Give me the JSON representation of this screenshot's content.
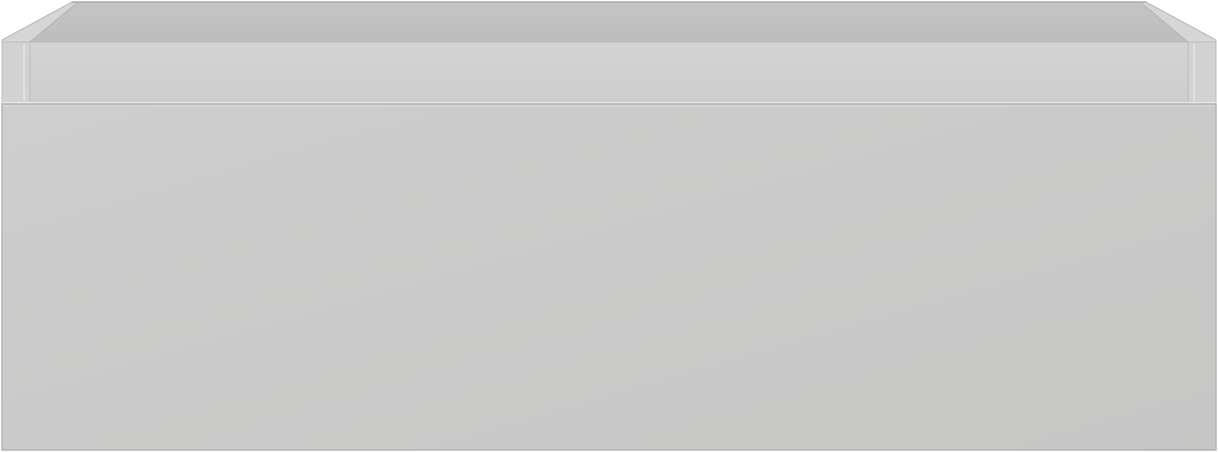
{
  "object": {
    "kind": "drawer-unit",
    "colors": {
      "body_light": "#cecece",
      "body_dark": "#c6c6c5",
      "inner_back": "#c2c2c2",
      "inner_floor": "#b9b9b9",
      "rim": "#d3d3d3",
      "edge": "#e8e8e8",
      "outline": "#b2b2b2"
    }
  }
}
